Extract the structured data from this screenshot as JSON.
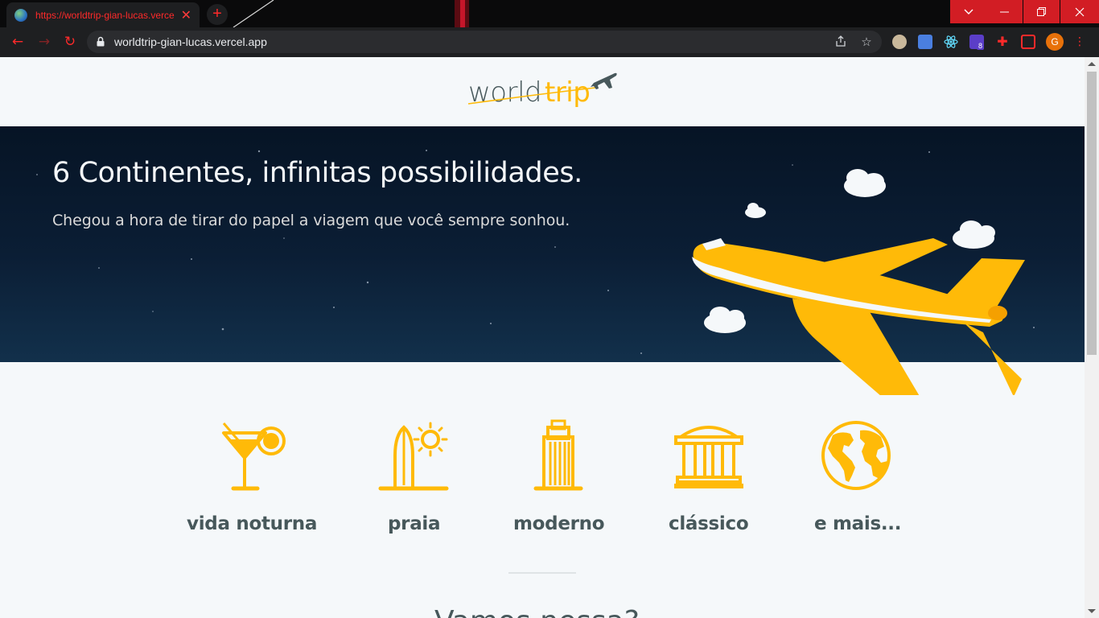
{
  "browser": {
    "tab_title": "https://worldtrip-gian-lucas.vercel.app",
    "url": "worldtrip-gian-lucas.vercel.app",
    "extension_badge": "8",
    "profile_initial": "G",
    "accent_color": "#ff2a2a"
  },
  "header": {
    "logo_part1": "world",
    "logo_part2": "trip"
  },
  "banner": {
    "title": "6 Continentes, infinitas possibilidades.",
    "subtitle": "Chegou a hora de tirar do papel a viagem que você sempre sonhou."
  },
  "travel_types": [
    {
      "label": "vida noturna",
      "icon": "cocktail-icon"
    },
    {
      "label": "praia",
      "icon": "surfboard-sun-icon"
    },
    {
      "label": "moderno",
      "icon": "skyscraper-icon"
    },
    {
      "label": "clássico",
      "icon": "museum-icon"
    },
    {
      "label": "e mais...",
      "icon": "globe-icon"
    }
  ],
  "section": {
    "cta": "Vamos nessa?"
  },
  "colors": {
    "highlight": "#ffba08",
    "dark_text": "#47585b",
    "light": "#f5f8fa"
  }
}
